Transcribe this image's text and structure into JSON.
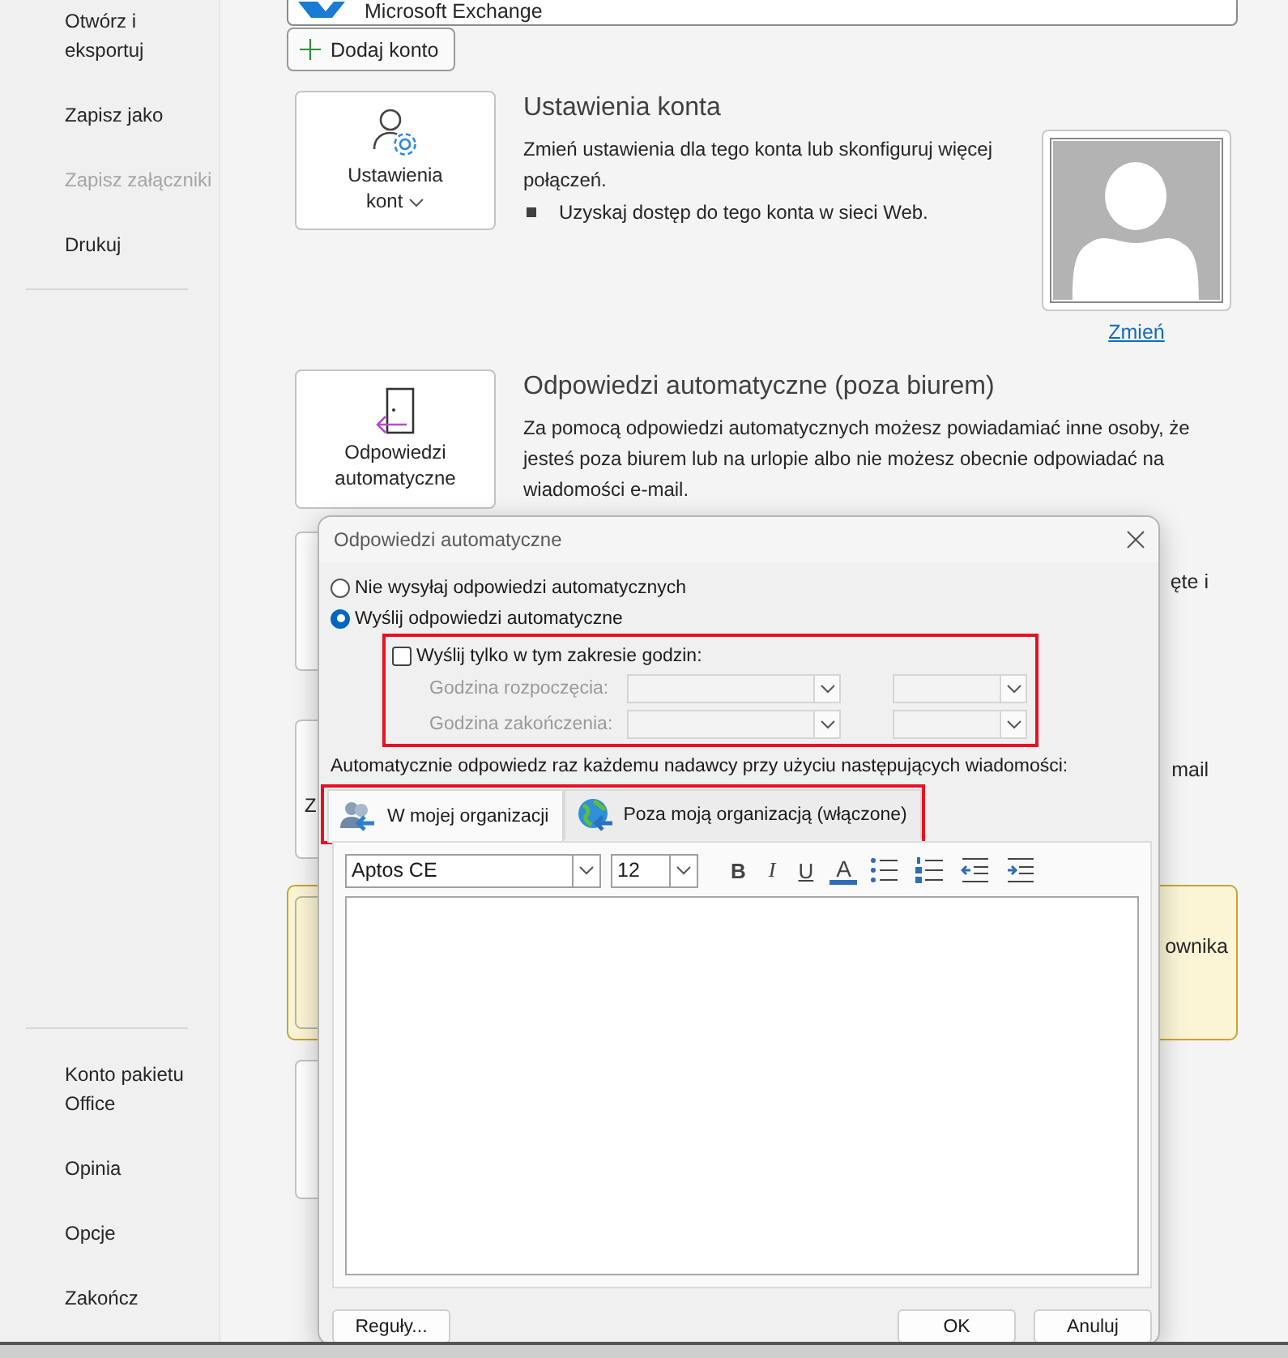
{
  "sidebar": {
    "top_items": [
      {
        "label": "Otwórz i eksportuj",
        "disabled": false
      },
      {
        "label": "Zapisz jako",
        "disabled": false
      },
      {
        "label": "Zapisz załączniki",
        "disabled": true
      },
      {
        "label": "Drukuj",
        "disabled": false
      }
    ],
    "bottom_items": [
      {
        "label": "Konto pakietu Office",
        "disabled": false
      },
      {
        "label": "Opinia",
        "disabled": false
      },
      {
        "label": "Opcje",
        "disabled": false
      },
      {
        "label": "Zakończ",
        "disabled": false
      }
    ]
  },
  "account": {
    "name": "Microsoft Exchange",
    "add_button": "Dodaj konto"
  },
  "sections": [
    {
      "button": "Ustawienia kont",
      "dropdown": true,
      "title": "Ustawienia konta",
      "text": "Zmień ustawienia dla tego konta lub skonfiguruj więcej połączeń.",
      "bullets": [
        "Uzyskaj dostęp do tego konta w sieci Web."
      ],
      "avatar_link": "Zmień"
    },
    {
      "button": "Odpowiedzi automatyczne",
      "dropdown": false,
      "title": "Odpowiedzi automatyczne (poza biurem)",
      "text": "Za pomocą odpowiedzi automatycznych możesz powiadamiać inne osoby, że jesteś poza biurem lub na urlopie albo nie możesz obecnie odpowiadać na wiadomości e-mail."
    }
  ],
  "hidden_sections": [
    {
      "kind": "plain",
      "text": "ęte i"
    },
    {
      "kind": "plain",
      "button": "Z",
      "text": "mail"
    },
    {
      "kind": "warning",
      "text": "ownika"
    },
    {
      "kind": "plain"
    }
  ],
  "dialog": {
    "title": "Odpowiedzi automatyczne",
    "options": [
      {
        "label": "Nie wysyłaj odpowiedzi automatycznych",
        "selected": false
      },
      {
        "label": "Wyślij odpowiedzi automatyczne",
        "selected": true
      }
    ],
    "time_range": {
      "label": "Wyślij tylko w tym zakresie godzin:",
      "checked": false,
      "highlighted": true,
      "rows": [
        {
          "label": "Godzina rozpoczęcia:",
          "disabled": true
        },
        {
          "label": "Godzina zakończenia:",
          "disabled": true
        }
      ]
    },
    "message_label": "Automatycznie odpowiedz raz każdemu nadawcy przy użyciu następujących wiadomości:",
    "tabs_highlighted": true,
    "tabs": [
      {
        "label": "W mojej organizacji",
        "selected": true
      },
      {
        "label": "Poza moją organizacją (włączone)",
        "selected": false
      }
    ],
    "editor": {
      "font": "Aptos CE",
      "size": "12",
      "format_buttons": [
        {
          "label": "B",
          "kind": "bold"
        },
        {
          "label": "I",
          "kind": "italic"
        },
        {
          "label": "U",
          "kind": "underline"
        },
        {
          "label": "A",
          "kind": "color"
        }
      ]
    },
    "buttons": {
      "rules": "Reguły...",
      "ok": "OK",
      "cancel": "Anuluj"
    }
  }
}
